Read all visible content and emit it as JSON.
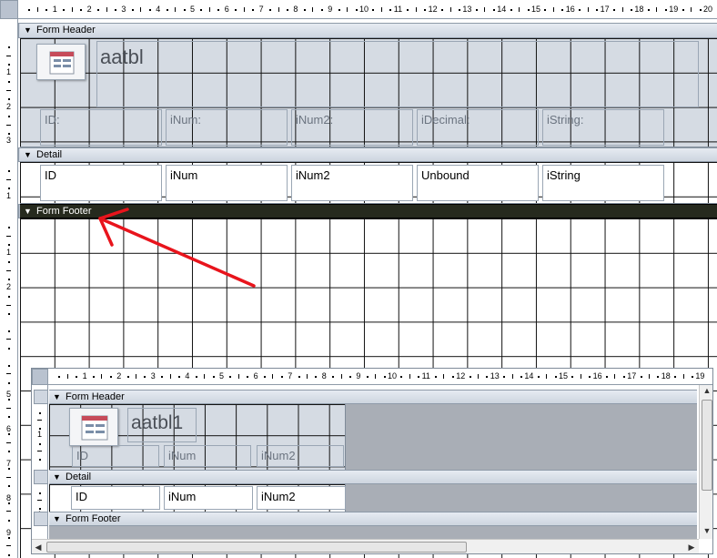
{
  "main_form": {
    "ruler_numbers": [
      "1",
      "2",
      "3",
      "4",
      "5",
      "6",
      "7",
      "8",
      "9",
      "10",
      "11",
      "12",
      "13",
      "14",
      "15",
      "16",
      "17",
      "18",
      "19",
      "20"
    ],
    "vruler_numbers": {
      "header": [
        "1",
        "2",
        "3"
      ],
      "detail": [
        "1"
      ],
      "footer": [
        "1",
        "2"
      ]
    },
    "sections": {
      "header": "Form Header",
      "detail": "Detail",
      "footer": "Form Footer"
    },
    "title": "aatbl",
    "header_labels": [
      "ID:",
      "iNum:",
      "iNum2:",
      "iDecimal:",
      "iString:"
    ],
    "detail_fields": [
      "ID",
      "iNum",
      "iNum2",
      "Unbound",
      "iString"
    ]
  },
  "sub_form": {
    "ruler_numbers": [
      "1",
      "2",
      "3",
      "4",
      "5",
      "6",
      "7",
      "8",
      "9",
      "10",
      "11",
      "12",
      "13",
      "14",
      "15",
      "16",
      "17",
      "18",
      "19"
    ],
    "vruler_numbers": {
      "header": [
        "1"
      ],
      "detail": [
        "1"
      ]
    },
    "outer_vruler_numbers": [
      "5",
      "6",
      "7",
      "8",
      "9"
    ],
    "sections": {
      "header": "Form Header",
      "detail": "Detail",
      "footer": "Form Footer"
    },
    "title": "aatbl1",
    "header_labels": [
      "ID",
      "iNum",
      "iNum2"
    ],
    "detail_fields": [
      "ID",
      "iNum",
      "iNum2"
    ]
  },
  "annotation": {
    "color": "#e8141c"
  },
  "colors": {
    "selected_band": "#262a1e",
    "header_bg": "#d5dbe3",
    "empty_area": "#a9aeb6"
  },
  "icons": {
    "form_icon": "form-icon",
    "band_toggle": "chevron-double-icon"
  }
}
